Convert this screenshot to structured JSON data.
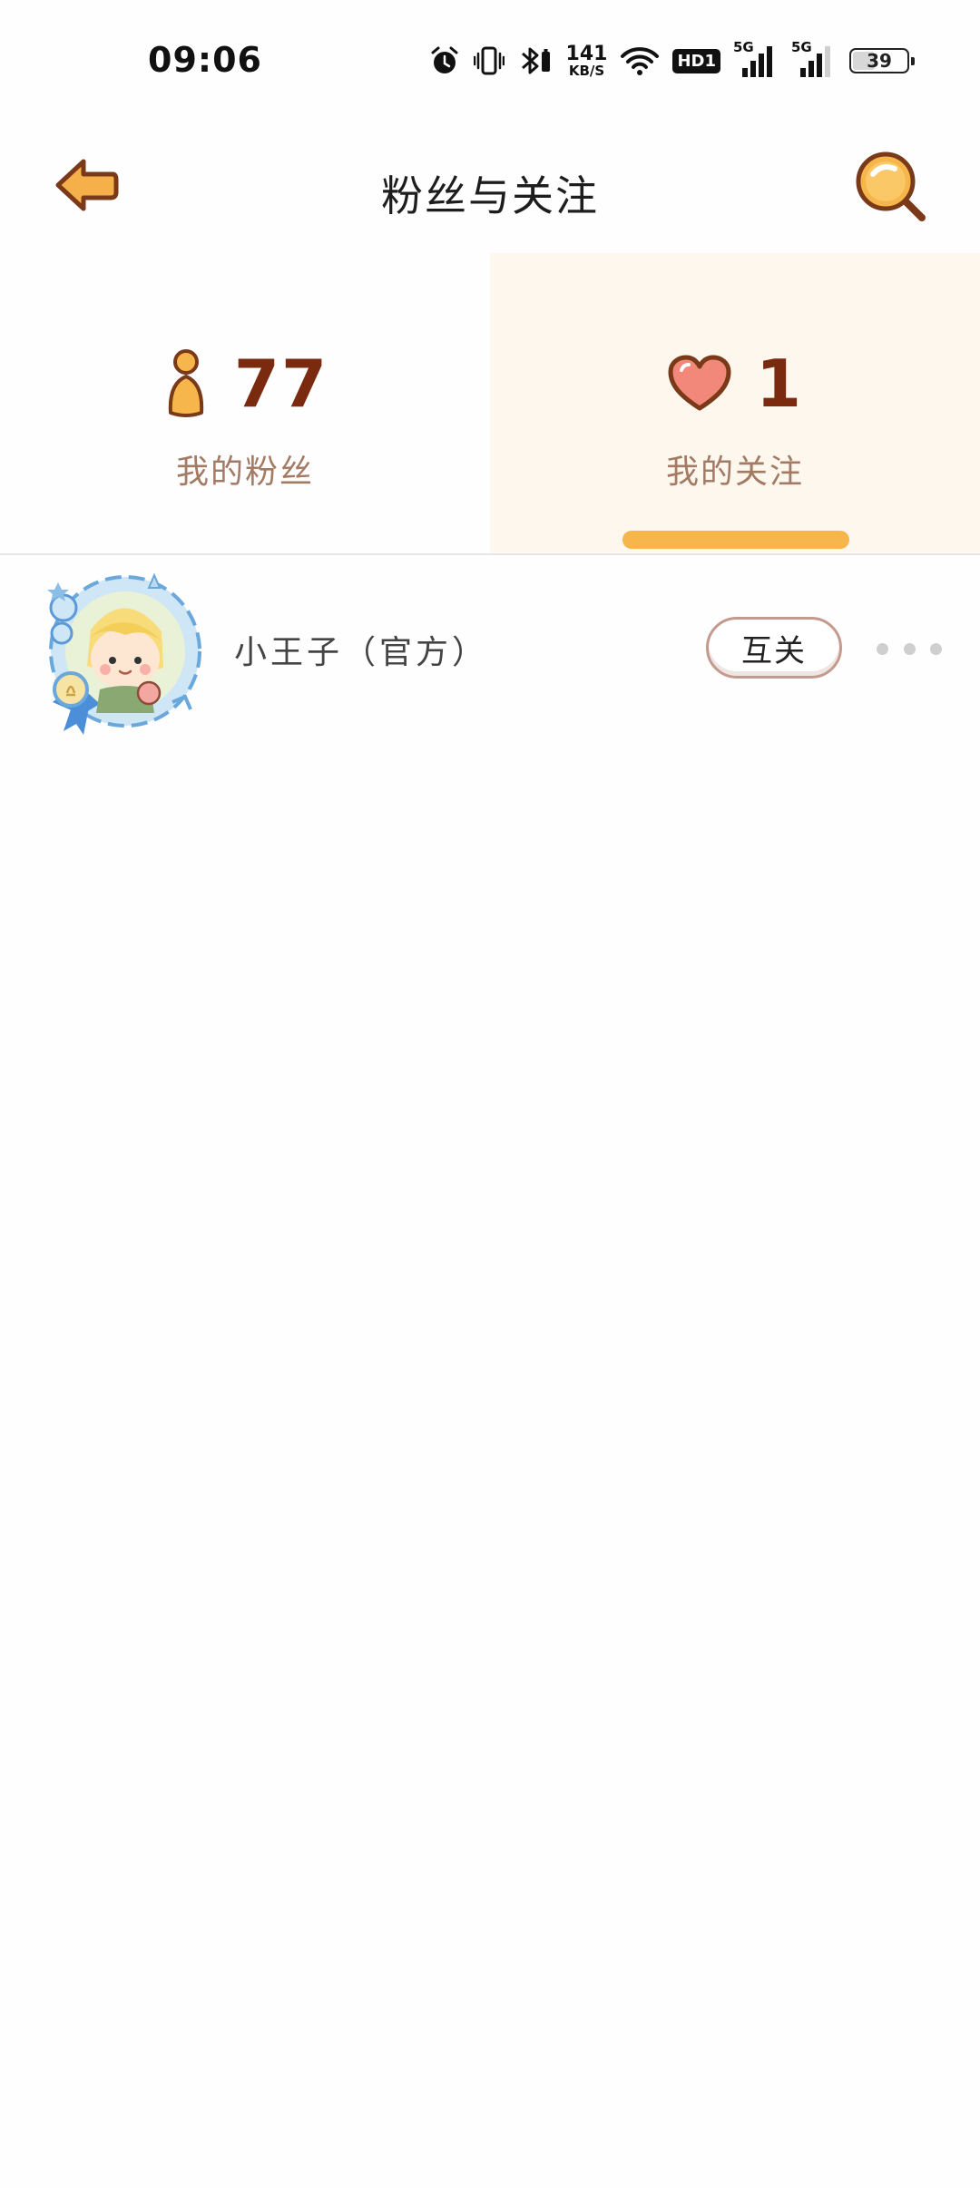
{
  "status_bar": {
    "time": "09:06",
    "net_speed_value": "141",
    "net_speed_unit": "KB/S",
    "hd_label": "HD1",
    "signal1_label": "5G",
    "signal2_label": "5G",
    "battery": "39",
    "icons": [
      "alarm-icon",
      "vibrate-icon",
      "bluetooth-icon",
      "wifi-icon",
      "hd-icon",
      "signal-icon",
      "battery-icon"
    ]
  },
  "header": {
    "title": "粉丝与关注",
    "back_icon": "back-arrow-icon",
    "search_icon": "magnifier-icon"
  },
  "tabs": [
    {
      "label": "我的粉丝",
      "count": "77",
      "icon": "person-icon",
      "active": false
    },
    {
      "label": "我的关注",
      "count": "1",
      "icon": "heart-icon",
      "active": true
    }
  ],
  "list": [
    {
      "name": "小王子（官方）",
      "button_label": "互关",
      "more_icon": "more-dots-icon"
    }
  ],
  "colors": {
    "accent": "#f7b64b",
    "count_text": "#7a2a0e",
    "label_text": "#a37a64",
    "active_tab_bg": "#fdf7ee"
  }
}
